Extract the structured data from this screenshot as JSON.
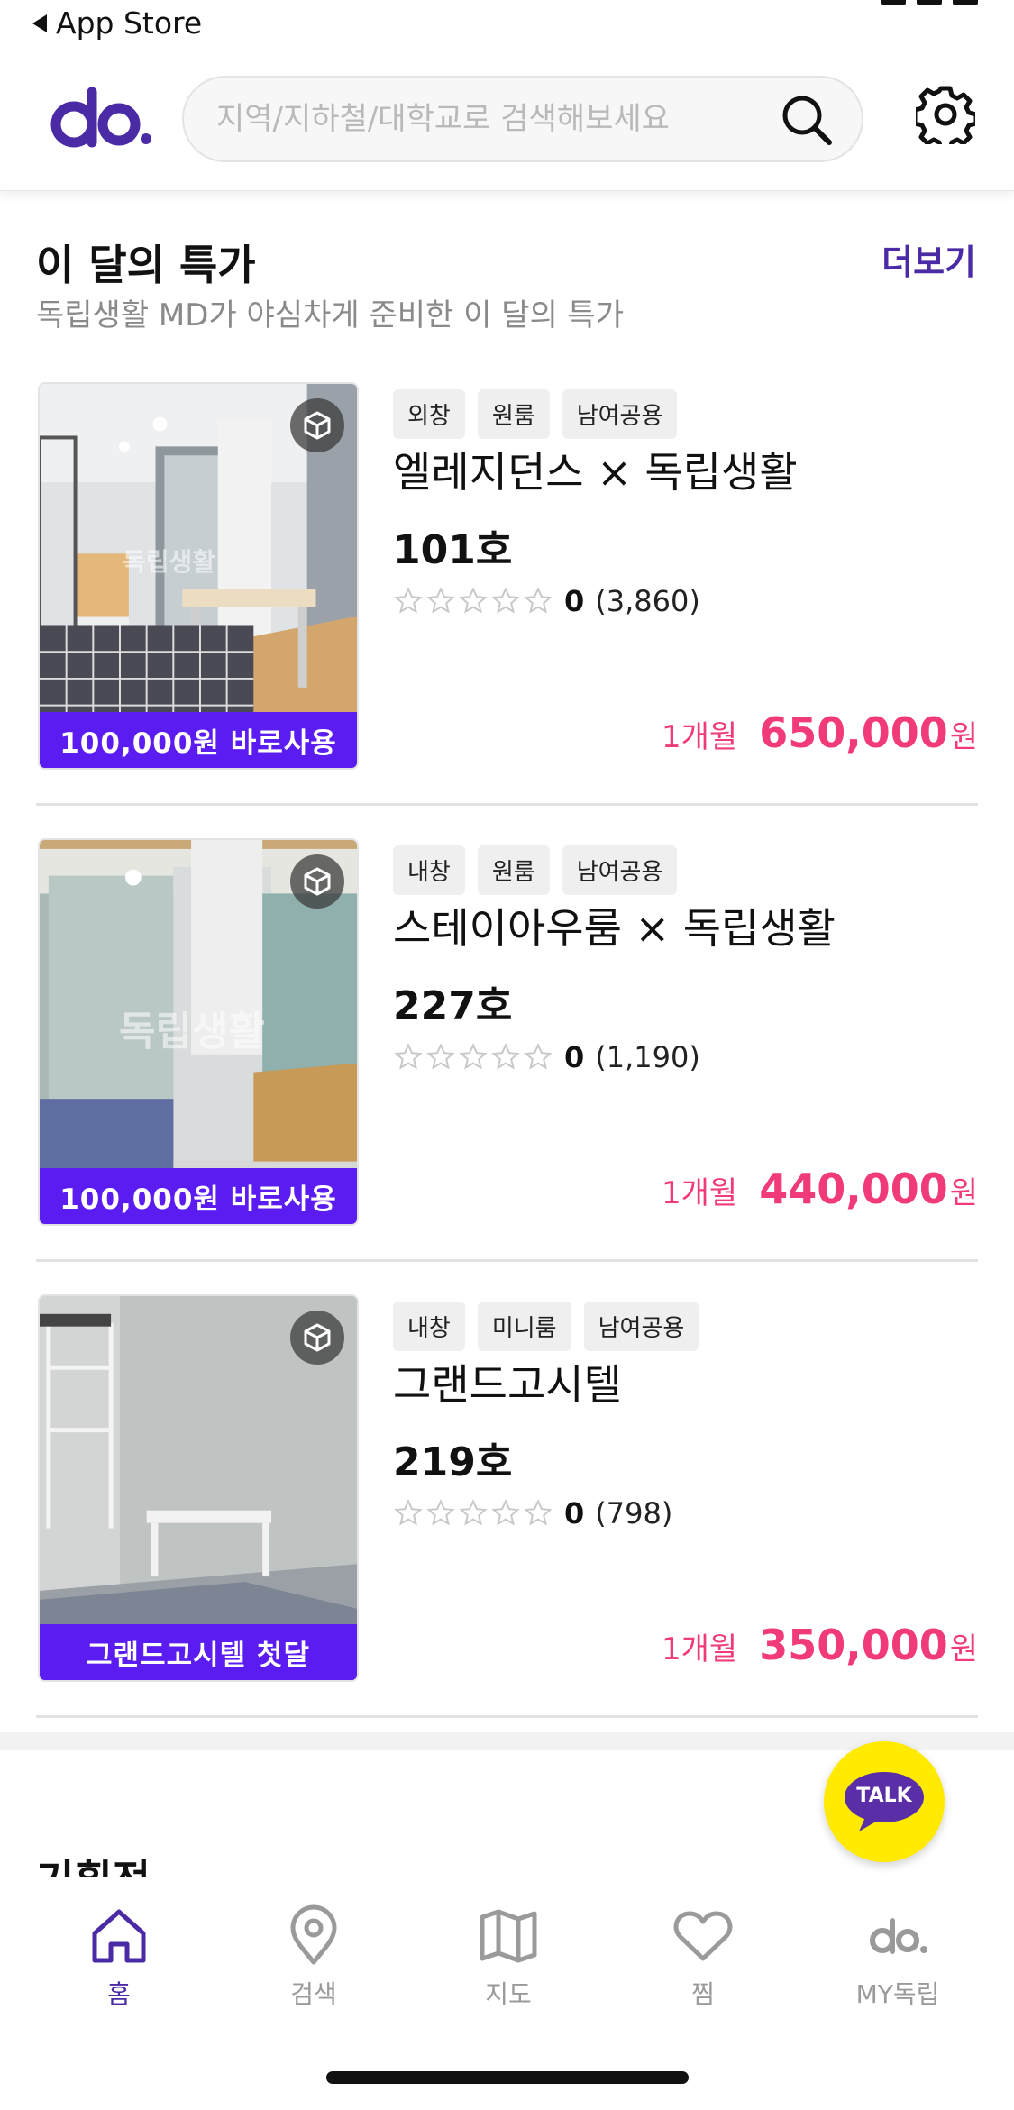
{
  "status_bar": {
    "back_label": "App Store"
  },
  "header": {
    "search_placeholder": "지역/지하철/대학교로 검색해보세요"
  },
  "section": {
    "title": "이 달의 특가",
    "more_label": "더보기",
    "subtitle": "독립생활 MD가 야심차게 준비한 이 달의 특가"
  },
  "listings": [
    {
      "tags": [
        "외창",
        "원룸",
        "남여공용"
      ],
      "name": "엘레지던스 × 독립생활",
      "room": "101호",
      "rating": "0",
      "reviews": "(3,860)",
      "banner": "100,000원 바로사용",
      "period": "1개월",
      "price": "650,000",
      "unit": "원",
      "watermark": "독립생활"
    },
    {
      "tags": [
        "내창",
        "원룸",
        "남여공용"
      ],
      "name": "스테이아우룸 × 독립생활",
      "room": "227호",
      "rating": "0",
      "reviews": "(1,190)",
      "banner": "100,000원 바로사용",
      "period": "1개월",
      "price": "440,000",
      "unit": "원",
      "watermark": "독립생활"
    },
    {
      "tags": [
        "내창",
        "미니룸",
        "남여공용"
      ],
      "name": "그랜드고시텔",
      "room": "219호",
      "rating": "0",
      "reviews": "(798)",
      "banner": "그랜드고시텔 첫달",
      "period": "1개월",
      "price": "350,000",
      "unit": "원",
      "watermark": ""
    }
  ],
  "next_section": {
    "title": "기획전"
  },
  "talk_fab": {
    "label": "TALK"
  },
  "bottom_nav": {
    "items": [
      {
        "label": "홈",
        "icon": "home-icon",
        "active": true
      },
      {
        "label": "검색",
        "icon": "location-pin-icon",
        "active": false
      },
      {
        "label": "지도",
        "icon": "map-icon",
        "active": false
      },
      {
        "label": "찜",
        "icon": "heart-icon",
        "active": false
      },
      {
        "label": "MY독립",
        "icon": "brand-logo-icon",
        "active": false
      }
    ]
  },
  "colors": {
    "brand": "#4b2aa5",
    "promo": "#5b1cf2",
    "price": "#f03a7a",
    "talk": "#ffea00"
  }
}
